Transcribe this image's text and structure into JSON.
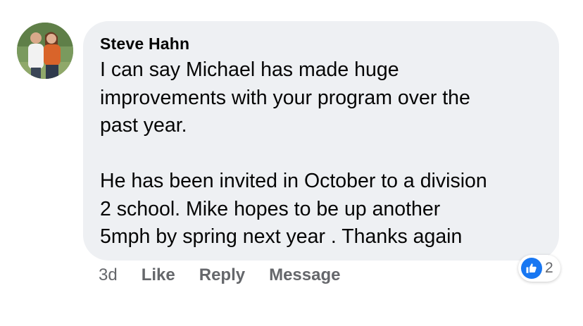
{
  "comment": {
    "author": "Steve Hahn",
    "text": "I can say Michael has made huge\nimprovements with your program over the\npast year.\n\nHe has been invited in October to a division\n2 school. Mike hopes to be up another\n5mph by spring next year . Thanks again",
    "timestamp": "3d",
    "actions": {
      "like": "Like",
      "reply": "Reply",
      "message": "Message"
    },
    "reactions": {
      "icon": "thumbs-up-icon",
      "count": "2"
    }
  },
  "colors": {
    "bubble": "#eef0f3",
    "text": "#050505",
    "secondary_text": "#65676b",
    "like_blue": "#1877f2"
  }
}
